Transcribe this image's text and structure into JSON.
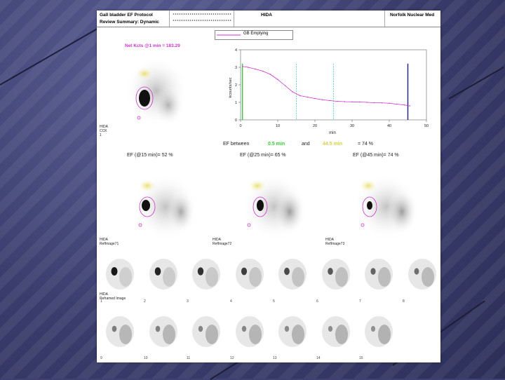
{
  "header": {
    "protocol": "Gall bladder EF Protocol",
    "summary": "Review Summary: Dynamic",
    "mask1": "****************************",
    "mask2": "****************************",
    "study": "HIDA",
    "institution": "Norfolk Nuclear Med"
  },
  "net_kcts": "Net Kcts @1 min = 183.29",
  "legend_label": "GB Emptying",
  "chart_data": {
    "type": "line",
    "title": "",
    "xlabel": "min",
    "ylabel": "kcounts/sec",
    "xlim": [
      0,
      50
    ],
    "ylim": [
      0,
      4
    ],
    "x_ticks": [
      "0",
      "10",
      "20",
      "30",
      "40",
      "50"
    ],
    "y_ticks": [
      "0",
      "1",
      "2",
      "3",
      "4"
    ],
    "series": [
      {
        "name": "GB Emptying",
        "color": "#cc33cc",
        "x": [
          0.5,
          2,
          4,
          6,
          8,
          10,
          12,
          14,
          16,
          18,
          20,
          22,
          24,
          26,
          28,
          30,
          32,
          34,
          36,
          38,
          40,
          42,
          44,
          45.5
        ],
        "y": [
          3.05,
          3.0,
          2.9,
          2.78,
          2.6,
          2.3,
          1.95,
          1.6,
          1.38,
          1.3,
          1.22,
          1.15,
          1.1,
          1.06,
          1.04,
          1.03,
          1.02,
          1.0,
          0.98,
          0.97,
          0.95,
          0.9,
          0.85,
          0.8
        ]
      }
    ],
    "markers": [
      {
        "x": 0.5,
        "color": "#33cc33"
      },
      {
        "x": 15,
        "color": "#33cccc"
      },
      {
        "x": 25,
        "color": "#33cccc"
      },
      {
        "x": 45,
        "color": "#1a1a99"
      }
    ]
  },
  "ef_summary": {
    "prefix": "EF between",
    "start": "0.5 min",
    "and": "and",
    "end": "44.5 min",
    "result": "= 74 %"
  },
  "top_image_label": "HIDA\nCCK\n1",
  "ef_results": [
    "EF (@15 min)= 52 %",
    "EF (@25 min)= 65 %",
    "EF (@45 min)= 74 %"
  ],
  "ref_labels": [
    "HIDA\nRefImage71",
    "HIDA\nRefImage72",
    "HIDA\nRefImage73"
  ],
  "frame_label": "HIDA\nReframed Image",
  "frame_numbers_row1": [
    "1",
    "2",
    "3",
    "4",
    "5",
    "6",
    "7",
    "8"
  ],
  "frame_numbers_row2": [
    "9",
    "10",
    "11",
    "12",
    "13",
    "14",
    "15"
  ]
}
